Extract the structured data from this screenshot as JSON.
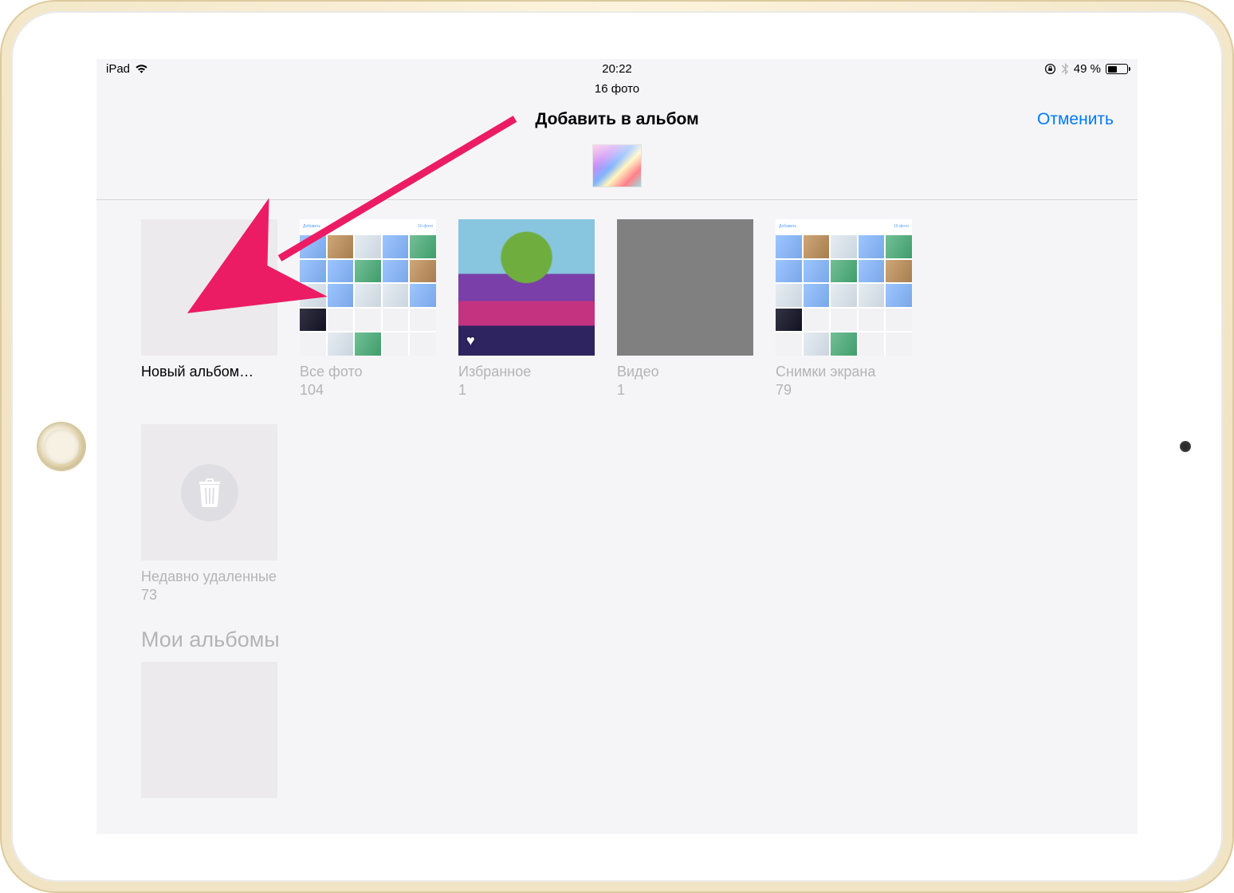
{
  "status": {
    "device": "iPad",
    "time": "20:22",
    "battery_pct": "49 %"
  },
  "context": {
    "photo_count": "16 фото"
  },
  "nav": {
    "title": "Добавить в альбом",
    "cancel": "Отменить"
  },
  "albums": [
    {
      "key": "new",
      "title": "Новый альбом…",
      "count": "",
      "enabled": true,
      "kind": "blank"
    },
    {
      "key": "all",
      "title": "Все фото",
      "count": "104",
      "enabled": false,
      "kind": "mosaic"
    },
    {
      "key": "fav",
      "title": "Избранное",
      "count": "1",
      "enabled": false,
      "kind": "tree",
      "heart": true
    },
    {
      "key": "video",
      "title": "Видео",
      "count": "1",
      "enabled": false,
      "kind": "gray"
    },
    {
      "key": "screenshots",
      "title": "Снимки экрана",
      "count": "79",
      "enabled": false,
      "kind": "mosaic"
    },
    {
      "key": "deleted",
      "title": "Недавно удаленные",
      "count": "73",
      "enabled": false,
      "kind": "trash"
    }
  ],
  "section": {
    "my_albums": "Мои альбомы"
  },
  "mosaic_header": {
    "left": "Добавить",
    "right": "16 фото"
  }
}
